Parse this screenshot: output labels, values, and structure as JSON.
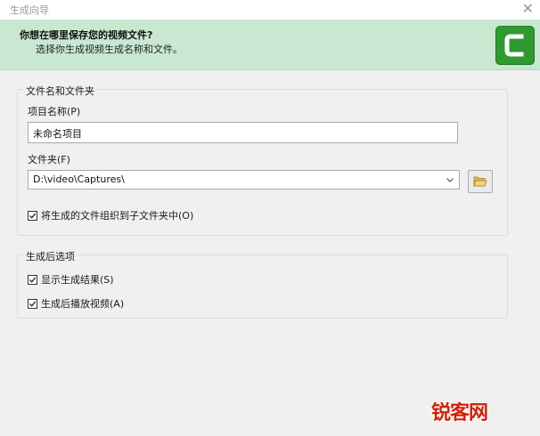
{
  "window": {
    "title": "生成向导",
    "close_glyph": "✕"
  },
  "header": {
    "question": "你想在哪里保存您的视频文件?",
    "subtitle": "选择你生成视频生成名称和文件。",
    "logo_icon": "camtasia-logo-icon",
    "logo_color": "#2f9a2f"
  },
  "file_group": {
    "title": "文件名和文件夹",
    "project_name_label": "项目名称(P)",
    "project_name_value": "未命名项目",
    "folder_label": "文件夹(F)",
    "folder_value": "D:\\video\\Captures\\",
    "organize_label": "将生成的文件组织到子文件夹中(O)",
    "organize_checked": true
  },
  "post_group": {
    "title": "生成后选项",
    "show_results_label": "显示生成结果(S)",
    "show_results_checked": true,
    "play_video_label": "生成后播放视频(A)",
    "play_video_checked": true
  },
  "watermark": {
    "text": "锐客网"
  }
}
